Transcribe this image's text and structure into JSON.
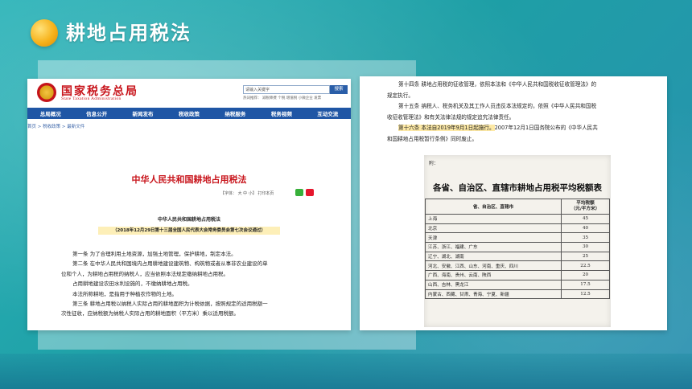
{
  "slide": {
    "title": "耕地占用税法"
  },
  "left": {
    "site_name": "国家税务总局",
    "site_name_en": "State Taxation Administration",
    "search_placeholder": "请输入关键字",
    "search_button": "搜索",
    "hot_words": "热词推荐：  减税降费  个税  增值税  小微企业  发票",
    "nav": [
      "总局概况",
      "信息公开",
      "新闻发布",
      "税收政策",
      "纳税服务",
      "税务视频",
      "互动交流"
    ],
    "breadcrumb": "首页 > 税收政策 > 最新文件",
    "doc_title": "中华人民共和国耕地占用税法",
    "font_tools": "【字体：  大  中  小】   打印本页",
    "doc_heading": "中华人民共和国耕地占用税法",
    "doc_sub": "（2018年12月29日第十三届全国人民代表大会常务委员会第七次会议通过）",
    "body": [
      "第一条   为了合理利用土地资源，加强土地管理，保护耕地，制定本法。",
      "第二条   在中华人民共和国境内占用耕地建设建筑物、构筑物或者从事非农业建设的单",
      "位和个人，为耕地占用税的纳税人，应当依照本法规定缴纳耕地占用税。",
      "占用耕地建设农田水利设施的，不缴纳耕地占用税。",
      "本法所称耕地，是指用于种植农作物的土地。",
      "第三条   耕地占用税以纳税人实际占用的耕地面积为计税依据，按照规定的适用税额一",
      "次性征收，应纳税额为纳税人实际占用的耕地面积（平方米）乘以适用税额。"
    ]
  },
  "right": {
    "body_lines": [
      "第十四条   耕地占用税的征收管理，依照本法和《中华人民共和国税收征收管理法》的",
      "规定执行。",
      "第十五条   纳税人、税务机关及其工作人员违反本法规定的，依照《中华人民共和国税",
      "收征收管理法》和有关法律法规的规定追究法律责任。"
    ],
    "art16_highlight": "第十六条   本法自2019年9月1日起施行。",
    "art16_rest": "2007年12月1日国务院公布的《中华人民共",
    "art16_line2": "和国耕地占用税暂行条例》同时废止。",
    "scan_label": "附：",
    "scan_title": "各省、自治区、直辖市耕地占用税平均税额表",
    "table_header": [
      "省、自治区、直辖市",
      "平均税额\n（元/平方米）"
    ],
    "table_rows": [
      [
        "上海",
        "45"
      ],
      [
        "北京",
        "40"
      ],
      [
        "天津",
        "35"
      ],
      [
        "江苏、浙江、福建、广东",
        "30"
      ],
      [
        "辽宁、湖北、湖南",
        "25"
      ],
      [
        "河北、安徽、江西、山东、河南、重庆、四川",
        "22.5"
      ],
      [
        "广西、海南、贵州、云南、陕西",
        "20"
      ],
      [
        "山西、吉林、黑龙江",
        "17.5"
      ],
      [
        "内蒙古、西藏、甘肃、青海、宁夏、新疆",
        "12.5"
      ]
    ]
  }
}
